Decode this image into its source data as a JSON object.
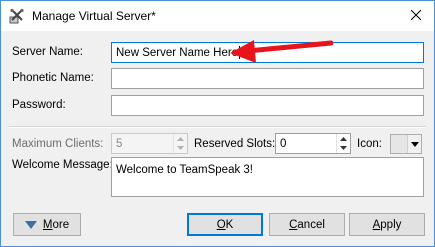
{
  "window": {
    "title": "Manage Virtual Server*",
    "icon": "server-tools-icon"
  },
  "form": {
    "server_name_label": "Server Name:",
    "server_name_value": "New Server Name Here",
    "phonetic_name_label": "Phonetic Name:",
    "phonetic_name_value": "",
    "password_label": "Password:",
    "password_value": "",
    "max_clients_label": "Maximum Clients:",
    "max_clients_value": "5",
    "reserved_slots_label": "Reserved Slots:",
    "reserved_slots_value": "0",
    "icon_label": "Icon:",
    "welcome_label": "Welcome Message:",
    "welcome_value": "Welcome to TeamSpeak 3!"
  },
  "buttons": {
    "more_label_prefix": "",
    "more_underline": "M",
    "more_rest": "ore",
    "ok_underline": "O",
    "ok_rest": "K",
    "cancel_underline": "C",
    "cancel_rest": "ancel",
    "apply_underline": "A",
    "apply_rest": "pply"
  },
  "colors": {
    "focus_border": "#0078d7",
    "annotation_arrow": "#e8141b",
    "more_arrow": "#3c6ea8"
  }
}
